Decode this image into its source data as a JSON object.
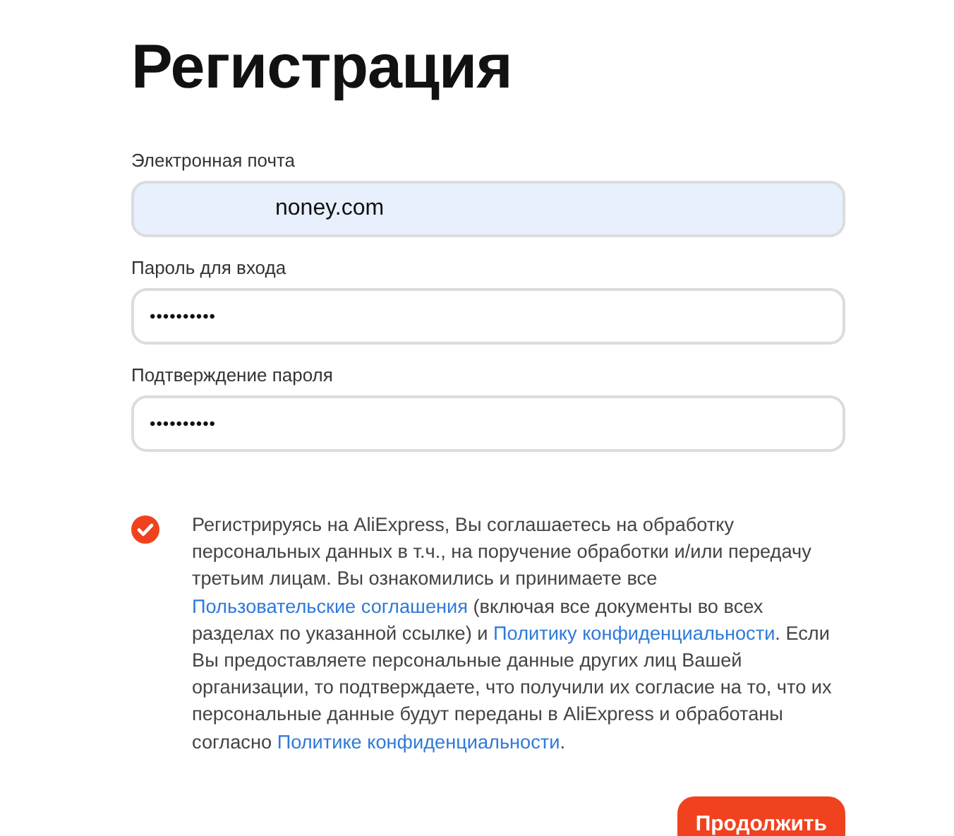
{
  "title": "Регистрация",
  "fields": [
    {
      "label": "Электронная почта",
      "value": "noney.com",
      "autofilled": true
    },
    {
      "label": "Пароль для входа",
      "value": "••••••••••",
      "autofilled": false
    },
    {
      "label": "Подтверждение пароля",
      "value": "••••••••••",
      "autofilled": false
    }
  ],
  "consent": {
    "checked": true,
    "segments": [
      {
        "kind": "text",
        "text": "Регистрируясь на AliExpress, Вы соглашаетесь на обработку персональных данных в т.ч., на поручение обработки и/или передачу третьим лицам. Вы ознакомились и принимаете все "
      },
      {
        "kind": "link",
        "text": "Пользовательские соглашения"
      },
      {
        "kind": "text",
        "text": " (включая все документы во всех разделах по указанной ссылке) и "
      },
      {
        "kind": "link",
        "text": "Политику конфиденциальности"
      },
      {
        "kind": "text",
        "text": ". Если Вы предоставляете персональные данные других лиц Вашей организации, то подтверждаете, что получили их согласие на то, что их персональные данные будут переданы в AliExpress и обработаны согласно "
      },
      {
        "kind": "link",
        "text": "Политике конфиденциальности"
      },
      {
        "kind": "text",
        "text": "."
      }
    ]
  },
  "submit": "Продолжить"
}
